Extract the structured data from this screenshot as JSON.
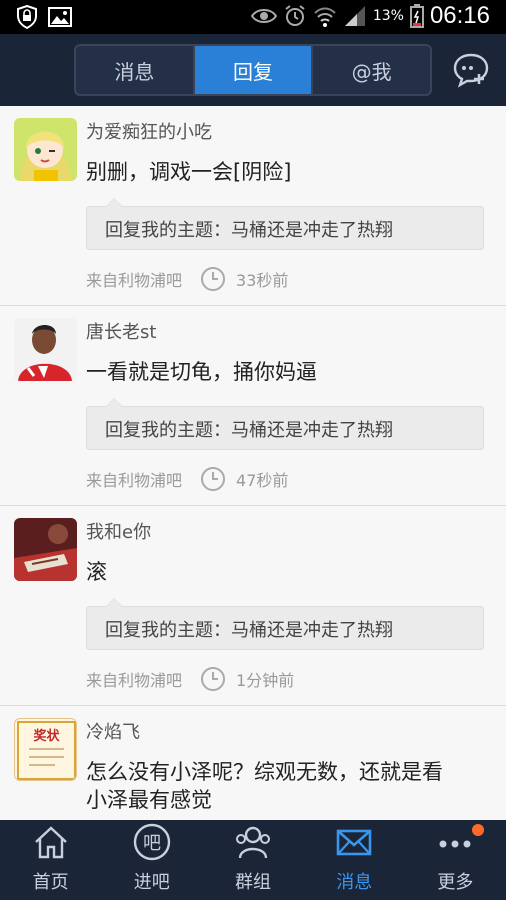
{
  "status_bar": {
    "battery_percent": "13%",
    "time": "06:16"
  },
  "header": {
    "tabs": [
      {
        "label": "消息",
        "active": false
      },
      {
        "label": "回复",
        "active": true
      },
      {
        "label": "@我",
        "active": false
      }
    ]
  },
  "feed": {
    "items": [
      {
        "username": "为爱痴狂的小吃",
        "message": "别删，调戏一会[阴险]",
        "quote": "回复我的主题：马桶还是冲走了热翔",
        "source": "来自利物浦吧",
        "time": "33秒前"
      },
      {
        "username": "唐长老st",
        "message": "一看就是切龟，捅你妈逼",
        "quote": "回复我的主题：马桶还是冲走了热翔",
        "source": "来自利物浦吧",
        "time": "47秒前"
      },
      {
        "username": "我和e你",
        "message": "滚",
        "quote": "回复我的主题：马桶还是冲走了热翔",
        "source": "来自利物浦吧",
        "time": "1分钟前"
      },
      {
        "username": "冷焰飞",
        "message_line1": "怎么没有小泽呢？综观无数，还就是看",
        "message_line2": "小泽最有感觉",
        "certificate_text": "奖状"
      }
    ]
  },
  "bottom_nav": {
    "items": [
      {
        "label": "首页",
        "icon": "home-icon"
      },
      {
        "label": "进吧",
        "icon": "bar-icon"
      },
      {
        "label": "群组",
        "icon": "group-icon"
      },
      {
        "label": "消息",
        "icon": "mail-icon",
        "active": true
      },
      {
        "label": "更多",
        "icon": "more-icon",
        "has_badge": true
      }
    ]
  },
  "colors": {
    "header_bg": "#1a2537",
    "active_tab": "#2a7fd6",
    "active_nav": "#3a95ec",
    "badge": "#ff6a2a"
  }
}
